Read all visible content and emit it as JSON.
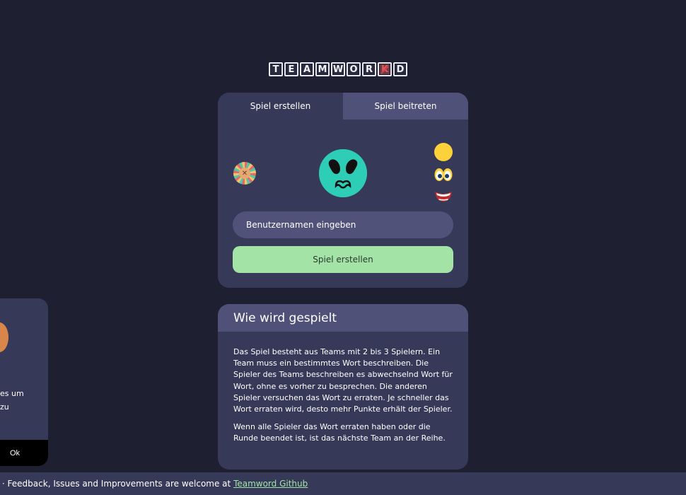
{
  "logo": {
    "letters": [
      "T",
      "E",
      "A",
      "M",
      "W",
      "O",
      "R",
      "K",
      "D"
    ]
  },
  "tabs": {
    "create": "Spiel erstellen",
    "join": "Spiel beitreten"
  },
  "form": {
    "username_placeholder": "Benutzernamen eingeben",
    "create_button": "Spiel erstellen"
  },
  "avatar": {
    "face_color": "#2ecdb5",
    "parts": [
      "skin-color-icon",
      "eyes-icon",
      "mouth-icon"
    ]
  },
  "how_to_play": {
    "title": "Wie wird gespielt",
    "paragraph1": "Das Spiel besteht aus Teams mit 2 bis 3 Spielern. Ein Team muss ein bestimmtes Wort beschreiben. Die Spieler des Teams beschreiben es abwechselnd Wort für Wort, ohne es vorher zu besprechen. Die anderen Spieler versuchen das Wort zu erraten. Je schneller das Wort erraten wird, desto mehr Punkte erhält der Spieler.",
    "paragraph2": "Wenn alle Spieler das Wort erraten haben oder die Runde beendet ist, ist das nächste Team an der Reihe."
  },
  "cookie": {
    "line1": "es um",
    "line2": "zu",
    "ok_label": "Ok"
  },
  "footer": {
    "text": "y · Feedback, Issues and Improvements are welcome at ",
    "link": "Teamword Github"
  },
  "colors": {
    "background": "#1f1f32",
    "card": "#363a58",
    "card_header": "#4f5178",
    "accent_green": "#a3e3a6",
    "avatar_teal": "#2ecdb5"
  }
}
